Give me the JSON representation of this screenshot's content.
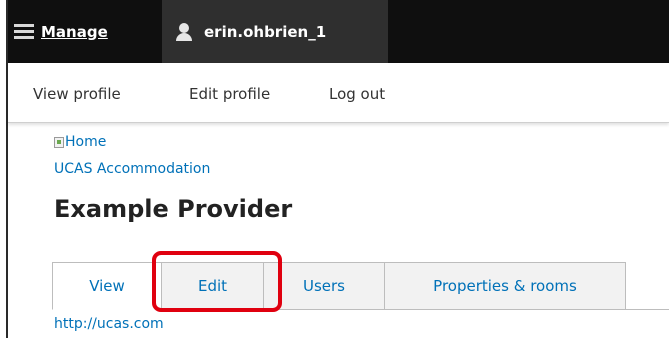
{
  "toolbar": {
    "manage_label": "Manage",
    "user_label": "erin.ohbrien_1"
  },
  "tray": {
    "links": [
      "View profile",
      "Edit profile",
      "Log out"
    ]
  },
  "content": {
    "home_alt": "Home",
    "site_name": "UCAS Accommodation",
    "page_title": "Example Provider",
    "url": "http://ucas.com"
  },
  "tabs": [
    {
      "label": "View",
      "active": true
    },
    {
      "label": "Edit",
      "active": false
    },
    {
      "label": "Users",
      "active": false
    },
    {
      "label": "Properties & rooms",
      "active": false
    }
  ],
  "colors": {
    "toolbar_bg": "#0f0f0f",
    "user_tab_bg": "#2f2f2f",
    "link": "#0071b8",
    "highlight": "#e0000f"
  },
  "icons": [
    "hamburger-icon",
    "user-icon",
    "broken-image-icon"
  ]
}
